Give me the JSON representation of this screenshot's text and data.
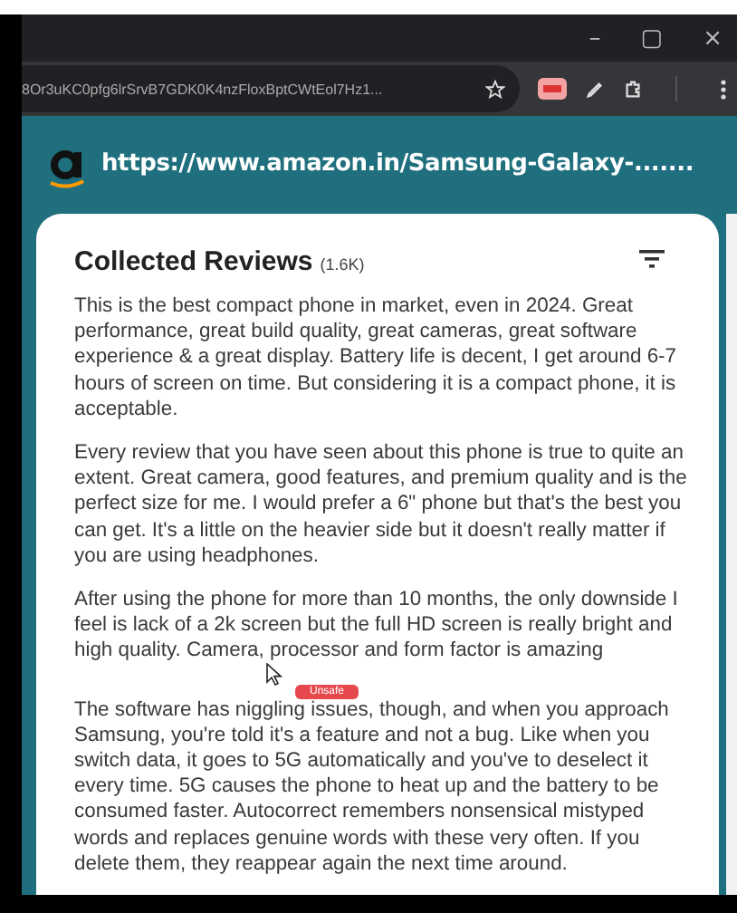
{
  "browser": {
    "window_controls": [
      "–",
      "▢",
      "×"
    ],
    "address": "8Or3uKC0pfg6lrSrvB7GDK0K4nzFloxBptCWtEol7Hz1..."
  },
  "header": {
    "url": "https://www.amazon.in/Samsung-Galaxy-......."
  },
  "reviews": {
    "title": "Collected Reviews",
    "count": "(1.6K)",
    "items": [
      {
        "text": "This is the best compact phone in market, even in 2024. Great performance, great build quality, great cameras, great software experience & a great display. Battery life is decent, I get around 6-7 hours of screen on time. But considering it is a compact phone, it is acceptable."
      },
      {
        "text": "Every review that you have seen about this phone is true to quite an extent. Great camera, good features, and premium quality and is the perfect size for me. I would prefer a 6\" phone but that's the best you can get. It's a little on the heavier side but it doesn't really matter if you are using headphones."
      },
      {
        "text": "After using the phone for more than 10 months, the only downside I feel is lack of a 2k screen but the full HD screen is really bright and high quality. Camera, processor and form factor is amazing",
        "tag": "Unsafe"
      },
      {
        "text": "The software has niggling issues, though, and when you approach Samsung, you're told it's a feature and not a bug. Like when you switch data, it goes to 5G automatically and you've to deselect it every time. 5G causes the phone to heat up and the battery to be consumed faster. Autocorrect remembers nonsensical mistyped words and replaces genuine words with these very often. If you delete them, they reappear again the next time around."
      }
    ]
  }
}
